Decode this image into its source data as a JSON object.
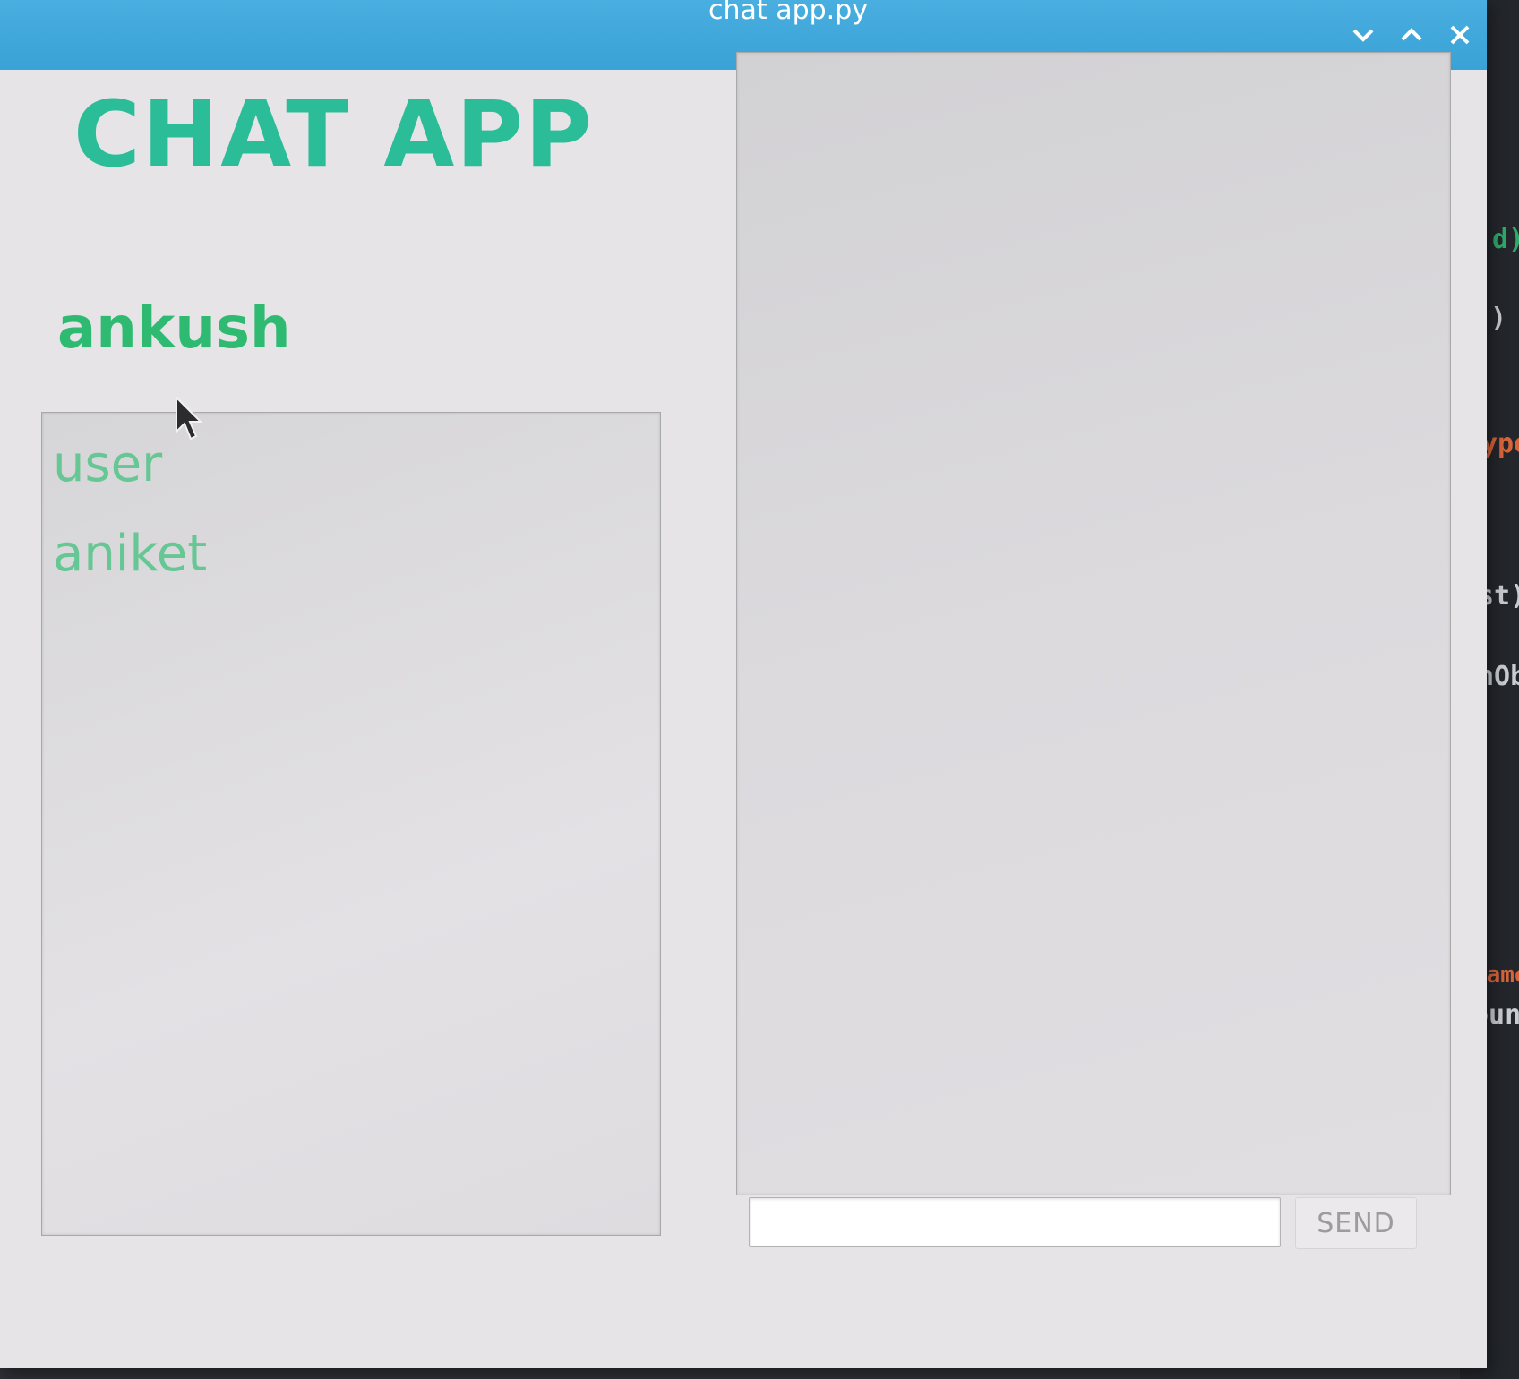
{
  "window": {
    "title": "chat app.py",
    "buttons": {
      "minimize_icon": "chevron-down-icon",
      "maximize_icon": "chevron-up-icon",
      "close_icon": "close-icon"
    }
  },
  "app": {
    "title": "CHAT APP",
    "current_user": "ankush"
  },
  "users": [
    "user",
    "aniket"
  ],
  "message": {
    "value": "",
    "placeholder": ""
  },
  "send_label": "SEND",
  "background_code": [
    "d)",
    ")",
    "ype",
    "st)",
    "nOb",
    "Name",
    "ount"
  ],
  "colors": {
    "titlebar": "#3aa2d6",
    "title_text": "#2bbc98",
    "username": "#2fba72",
    "user_item": "#66c795"
  }
}
